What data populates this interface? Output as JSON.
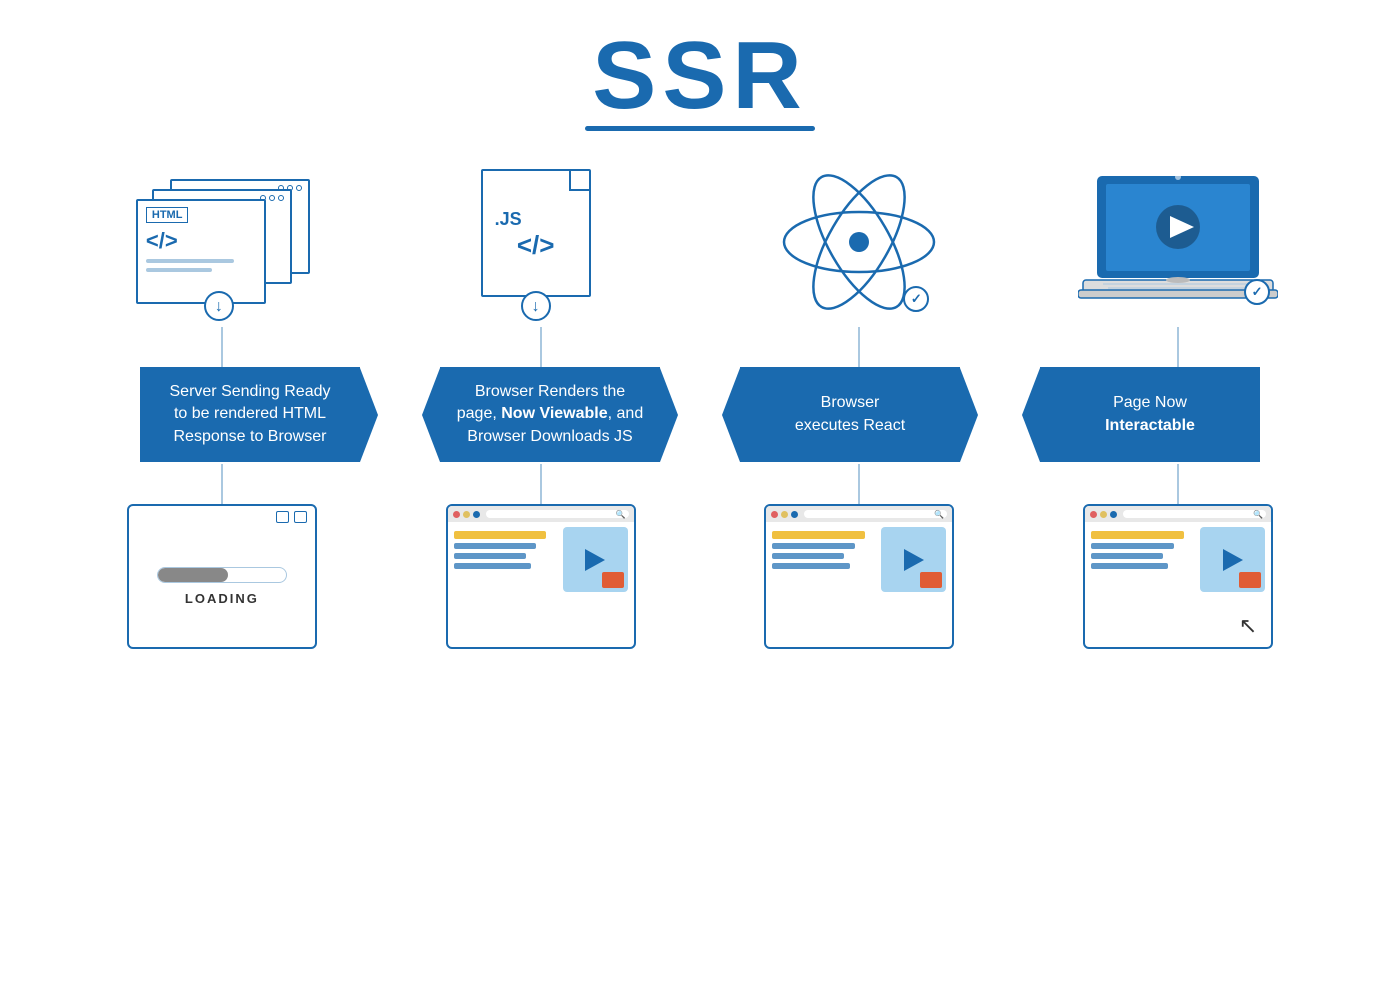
{
  "title": "SSR",
  "subtitle_underline": true,
  "columns": [
    {
      "id": "col1",
      "icon_type": "html_stack",
      "label_line1": "Server Sending Ready",
      "label_line2": "to be rendered HTML",
      "label_line3": "Response to Browser",
      "label_bold": "",
      "screen_type": "loading",
      "screen_loading_text": "LOADING"
    },
    {
      "id": "col2",
      "icon_type": "js_file",
      "label_line1": "Browser Renders the",
      "label_line2": "page, ",
      "label_bold": "Now Viewable",
      "label_line3": ", and",
      "label_line4": "Browser Downloads JS",
      "screen_type": "browser",
      "screen_content": "viewable"
    },
    {
      "id": "col3",
      "icon_type": "react_atom",
      "label_line1": "Browser",
      "label_line2": "executes React",
      "label_bold": "",
      "screen_type": "browser",
      "screen_content": "react"
    },
    {
      "id": "col4",
      "icon_type": "laptop",
      "label_line1": "Page Now",
      "label_line2": "",
      "label_bold": "Interactable",
      "screen_type": "browser",
      "screen_content": "interactable"
    }
  ],
  "arrow_labels": {
    "right_arrow": "→"
  }
}
